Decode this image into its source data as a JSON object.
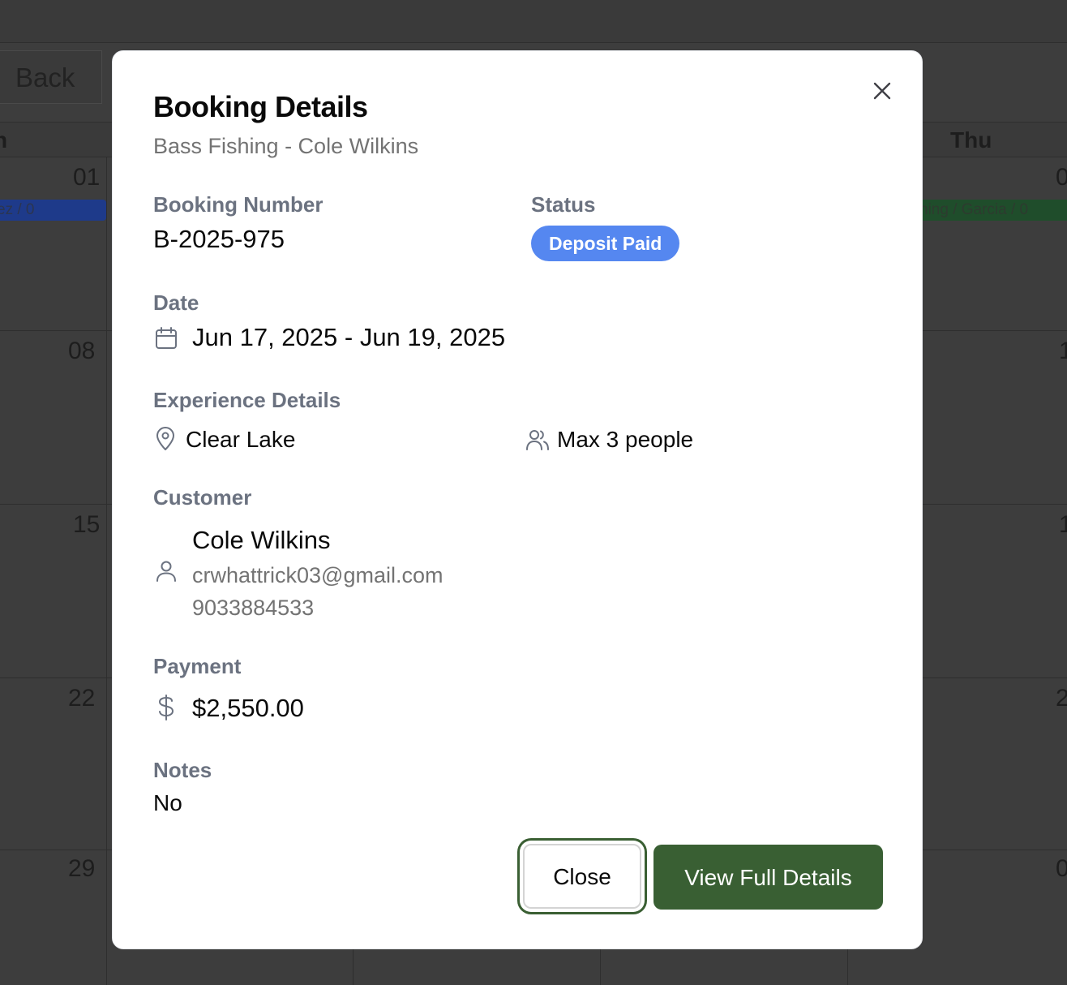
{
  "background": {
    "back_label": "Back",
    "day_names": [
      "n",
      "Thu"
    ],
    "dates": [
      {
        "left": "01",
        "right": "0"
      },
      {
        "left": "08",
        "right": "1"
      },
      {
        "left": "15",
        "right": "1"
      },
      {
        "left": "22",
        "right": "2"
      },
      {
        "left": "29",
        "right": "0"
      }
    ],
    "events": {
      "left": "ez / 0",
      "right": "hing / Garcia / 0"
    }
  },
  "modal": {
    "title": "Booking Details",
    "subtitle": "Bass Fishing - Cole Wilkins",
    "booking_number_label": "Booking Number",
    "booking_number": "B-2025-975",
    "status_label": "Status",
    "status": "Deposit Paid",
    "date_label": "Date",
    "date_range": "Jun 17, 2025 - Jun 19, 2025",
    "experience_label": "Experience Details",
    "location": "Clear Lake",
    "capacity": "Max 3 people",
    "customer_label": "Customer",
    "customer_name": "Cole Wilkins",
    "customer_email": "crwhattrick03@gmail.com",
    "customer_phone": "9033884533",
    "payment_label": "Payment",
    "payment_amount": "$2,550.00",
    "notes_label": "Notes",
    "notes": "No",
    "close_button": "Close",
    "view_button": "View Full Details"
  },
  "colors": {
    "badge": "#5587f0",
    "primary_button": "#395f33",
    "focus_ring": "#3a5f33",
    "event_blue": "#1e3a8a",
    "event_green": "#1f4d2b"
  }
}
